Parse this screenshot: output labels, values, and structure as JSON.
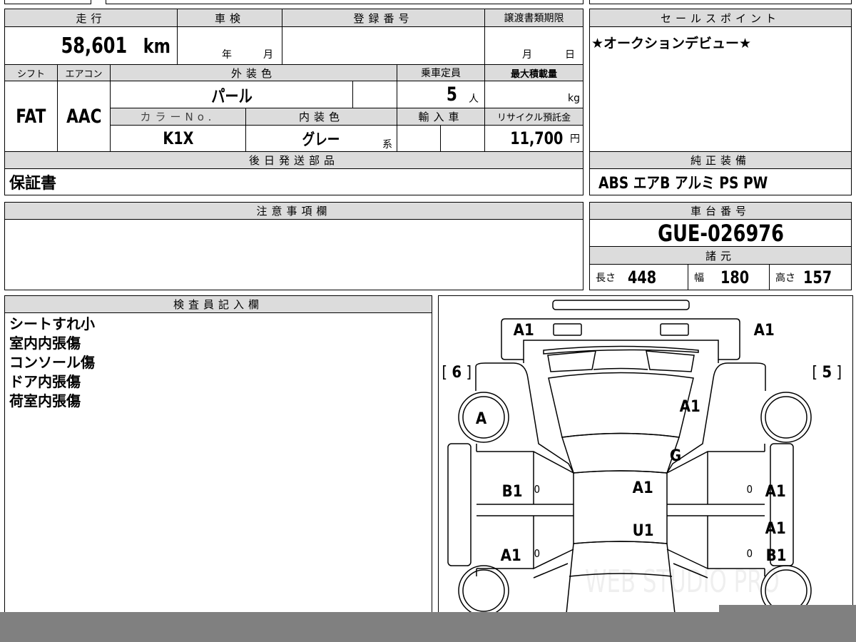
{
  "sheet": {
    "mileage": {
      "label": "走行",
      "value": "58,601",
      "unit": "km"
    },
    "inspection": {
      "label": "車検",
      "year": "年",
      "month": "月"
    },
    "registration": {
      "label": "登録番号",
      "value": ""
    },
    "transfer_deadline": {
      "label": "譲渡書類期限",
      "month": "月",
      "day": "日"
    },
    "shift": {
      "label": "シフト",
      "value": "FAT"
    },
    "aircon": {
      "label": "エアコン",
      "value": "AAC"
    },
    "exterior_color": {
      "label": "外装色",
      "value": "パール"
    },
    "capacity": {
      "label": "乗車定員",
      "value": "5",
      "unit": "人"
    },
    "max_load": {
      "label": "最大積載量",
      "unit": "kg"
    },
    "color_no": {
      "label": "カラーNo.",
      "value": "K1X"
    },
    "interior_color": {
      "label": "内装色",
      "value": "グレー",
      "suffix": "系"
    },
    "import": {
      "label": "輸入車"
    },
    "recycle": {
      "label": "リサイクル預託金",
      "value": "11,700",
      "unit": "円"
    },
    "later_parts": {
      "label": "後日発送部品",
      "value": "保証書"
    },
    "sales_point": {
      "label": "セールスポイント",
      "value": "★オークションデビュー★"
    },
    "equipment": {
      "label": "純正装備",
      "value": "ABS エアB アルミ PS PW"
    },
    "notes": {
      "label": "注意事項欄",
      "value": ""
    },
    "chassis": {
      "label": "車台番号",
      "value": "GUE-026976"
    },
    "specs": {
      "label": "諸元",
      "length_label": "長さ",
      "length": "448",
      "width_label": "幅",
      "width": "180",
      "height_label": "高さ",
      "height": "157"
    },
    "inspector": {
      "label": "検査員記入欄",
      "lines": [
        "シートすれ小",
        "室内内張傷",
        "コンソール傷",
        "ドア内張傷",
        "荷室内張傷"
      ]
    },
    "diagram": {
      "marks": {
        "rear_left": "A1",
        "rear_right": "A1",
        "rear_glass": "A1",
        "tire_front_left": "A",
        "tailgate": "G",
        "roof": "A1",
        "roof_rear": "U1",
        "left_rear_door": "B1",
        "left_front_door": "A1",
        "right_rear_door": "A1",
        "right_front_top": "A1",
        "right_front_door": "B1",
        "tread_left_rear": "0",
        "tread_left_front": "0",
        "tread_right_rear": "0",
        "tread_right_front": "0"
      },
      "tread_left": "6",
      "tread_right": "5",
      "watermark": "WEB STUDIO PRO"
    }
  }
}
